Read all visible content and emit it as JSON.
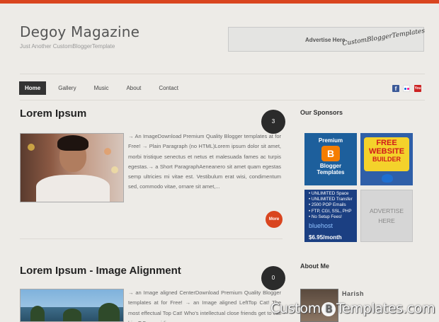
{
  "site": {
    "title": "Degoy Magazine",
    "tagline": "Just Another CustomBloggerTemplate"
  },
  "header_ad": {
    "label": "Advertise Here",
    "script": "CustomBloggerTemplates"
  },
  "nav": {
    "items": [
      "Home",
      "Gallery",
      "Music",
      "About",
      "Contact"
    ],
    "active": "Home"
  },
  "social": {
    "icons": [
      "facebook-icon",
      "flickr-icon",
      "youtube-icon"
    ],
    "facebook_glyph": "f",
    "youtube_glyph": "You"
  },
  "posts": [
    {
      "title": "Lorem Ipsum",
      "comments": "3",
      "excerpt": "→ An ImageDownload Premium Quality Blogger templates at for Free! → Plain Paragraph (no HTML)Lorem ipsum dolor sit amet, morbi tristique senectus et netus et malesuada fames ac turpis egestas.→ a Short ParagraphAeneanero sit amet quam egestas semp ultricies mi vitae est. Vestibulum erat wisi, condimentum sed, commodo vitae, ornare sit amet,...",
      "more_label": "More"
    },
    {
      "title": "Lorem Ipsum - Image Alignment",
      "comments": "0",
      "excerpt": "→ an Image aligned CenterDownload Premium Quality Blogger templates at for Free! → an Image aligned LeftTop Cat! The most effectual Top Cat! Who's intellectual close friends get to call him T.C., providing"
    }
  ],
  "sidebar": {
    "sponsors_title": "Our Sponsors",
    "sponsors": {
      "blogger": {
        "line1": "Premium",
        "logo": "B",
        "line2": "Blogger",
        "line3": "Templates"
      },
      "website_builder": {
        "line1": "FREE",
        "line2": "WEBSITE",
        "line3": "BUILDER"
      },
      "bluehost": {
        "lines": [
          "• UNLIMITED Space",
          "• UNLIMITED Transfer",
          "• 2500 POP Emails",
          "• FTP, CGI, SSL, PHP",
          "• No Setup Fees!"
        ],
        "brand": "bluehost",
        "price": "$6.95/month"
      },
      "advertise": {
        "line1": "ADVERTISE",
        "line2": "HERE"
      }
    },
    "about_title": "About Me",
    "about_name": "Harish"
  },
  "watermark": {
    "left": "Custom",
    "mark": "B",
    "right": "Templates.com"
  },
  "colors": {
    "accent": "#d9451f",
    "background": "#edebe7",
    "dark": "#2b2b2b"
  }
}
